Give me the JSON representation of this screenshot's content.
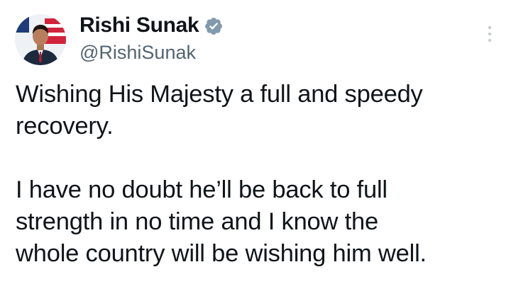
{
  "author": {
    "display_name": "Rishi Sunak",
    "handle": "@RishiSunak",
    "verified": true,
    "verified_color": "#829aab",
    "avatar_icon": "profile-photo"
  },
  "header": {
    "more_icon": "more-vertical-icon"
  },
  "tweet": {
    "paragraphs": [
      "Wishing His Majesty a full and speedy\nrecovery.",
      "I have no doubt he’ll be back to full\nstrength in no time and I know the\nwhole country will be wishing him well."
    ]
  },
  "colors": {
    "text": "#0f1419",
    "secondary_text": "#536471",
    "background": "#ffffff"
  }
}
